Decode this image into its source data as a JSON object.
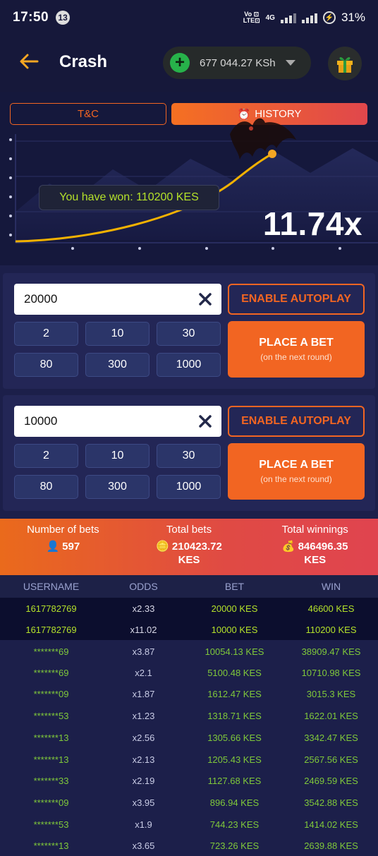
{
  "status_bar": {
    "time": "17:50",
    "badge": "13",
    "network": "Vo LTE 4G",
    "battery": "31%"
  },
  "header": {
    "title": "Crash",
    "balance": "677 044.27 KSh",
    "icons": [
      "back-arrow-icon",
      "plus-icon",
      "chevron-down-icon",
      "gift-icon"
    ]
  },
  "game": {
    "tabs": {
      "tc": "T&C",
      "history": "HISTORY"
    },
    "won_message": "You have won: 110200 KES",
    "multiplier": "11.74x"
  },
  "bets": [
    {
      "amount": "20000",
      "autoplay": "ENABLE AUTOPLAY",
      "chips": [
        "2",
        "10",
        "30",
        "80",
        "300",
        "1000"
      ],
      "place_label": "PLACE A BET",
      "place_sub": "(on the next round)"
    },
    {
      "amount": "10000",
      "autoplay": "ENABLE AUTOPLAY",
      "chips": [
        "2",
        "10",
        "30",
        "80",
        "300",
        "1000"
      ],
      "place_label": "PLACE A BET",
      "place_sub": "(on the next round)"
    }
  ],
  "summary": {
    "num_bets_label": "Number of bets",
    "num_bets": "597",
    "total_bets_label": "Total bets",
    "total_bets": "210423.72",
    "total_bets_unit": "KES",
    "total_win_label": "Total winnings",
    "total_win": "846496.35",
    "total_win_unit": "KES"
  },
  "table": {
    "headers": [
      "USERNAME",
      "ODDS",
      "BET",
      "WIN"
    ],
    "rows": [
      [
        "1617782769",
        "x2.33",
        "20000 KES",
        "46600 KES"
      ],
      [
        "1617782769",
        "x11.02",
        "10000 KES",
        "110200 KES"
      ],
      [
        "*******69",
        "x3.87",
        "10054.13 KES",
        "38909.47 KES"
      ],
      [
        "*******69",
        "x2.1",
        "5100.48 KES",
        "10710.98 KES"
      ],
      [
        "*******09",
        "x1.87",
        "1612.47 KES",
        "3015.3 KES"
      ],
      [
        "*******53",
        "x1.23",
        "1318.71 KES",
        "1622.01 KES"
      ],
      [
        "*******13",
        "x2.56",
        "1305.66 KES",
        "3342.47 KES"
      ],
      [
        "*******13",
        "x2.13",
        "1205.43 KES",
        "2567.56 KES"
      ],
      [
        "*******33",
        "x2.19",
        "1127.68 KES",
        "2469.59 KES"
      ],
      [
        "*******09",
        "x3.95",
        "896.94 KES",
        "3542.88 KES"
      ],
      [
        "*******53",
        "x1.9",
        "744.23 KES",
        "1414.02 KES"
      ],
      [
        "*******13",
        "x3.65",
        "723.26 KES",
        "2639.88 KES"
      ]
    ]
  },
  "colors": {
    "accent": "#f26522",
    "win_green": "#b5e22a",
    "background": "#1c1f4a"
  }
}
